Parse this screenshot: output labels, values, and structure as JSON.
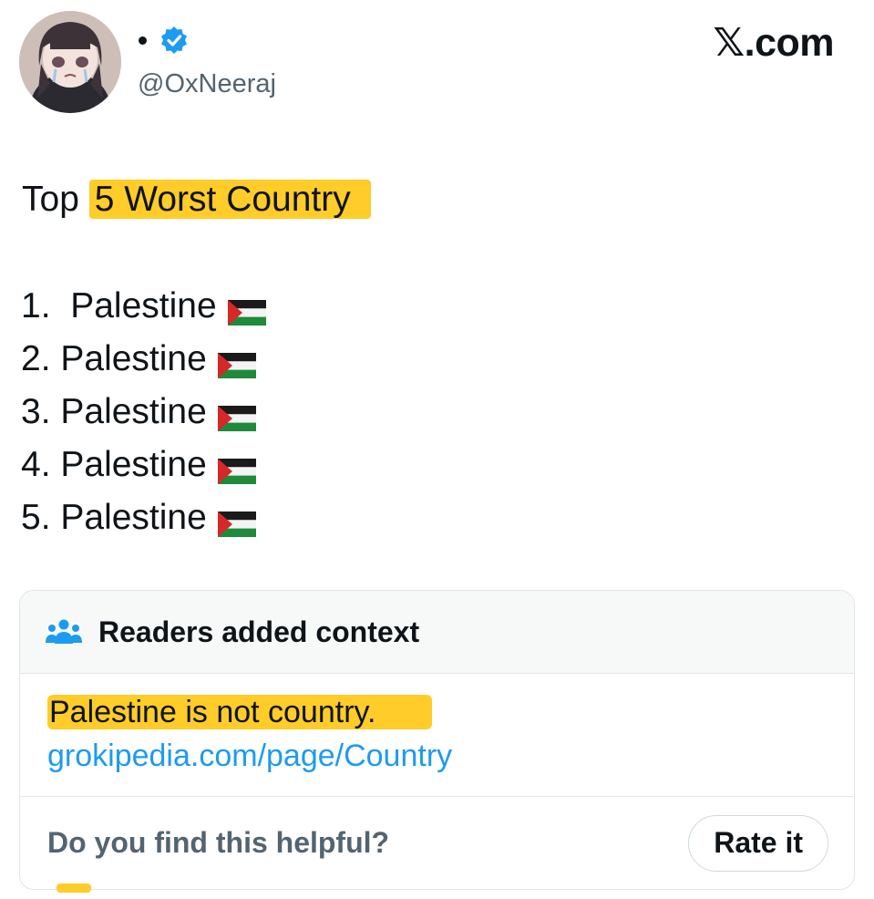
{
  "author": {
    "display_name": "•",
    "handle": "@OxNeeraj",
    "verified_icon": "verified-badge-icon",
    "avatar_icon": "anime-girl-avatar"
  },
  "brand": "𝕏.com",
  "post": {
    "title_prefix": "Top ",
    "title_highlight": "5 Worst Country",
    "items": [
      {
        "text": "1.  Palestine"
      },
      {
        "text": "2. Palestine"
      },
      {
        "text": "3. Palestine"
      },
      {
        "text": "4. Palestine"
      },
      {
        "text": "5. Palestine"
      }
    ],
    "flag_icon": "palestine-flag-emoji"
  },
  "community_note": {
    "icon": "people-icon",
    "title": "Readers added context",
    "text": "Palestine is not country.",
    "link": "grokipedia.com/page/Country",
    "helpful_prompt": "Do you find this helpful?",
    "rate_button": "Rate it"
  },
  "colors": {
    "highlight": "#ffcc29",
    "link": "#1d9bf0",
    "verified": "#1d9bf0",
    "secondary_text": "#536471"
  }
}
